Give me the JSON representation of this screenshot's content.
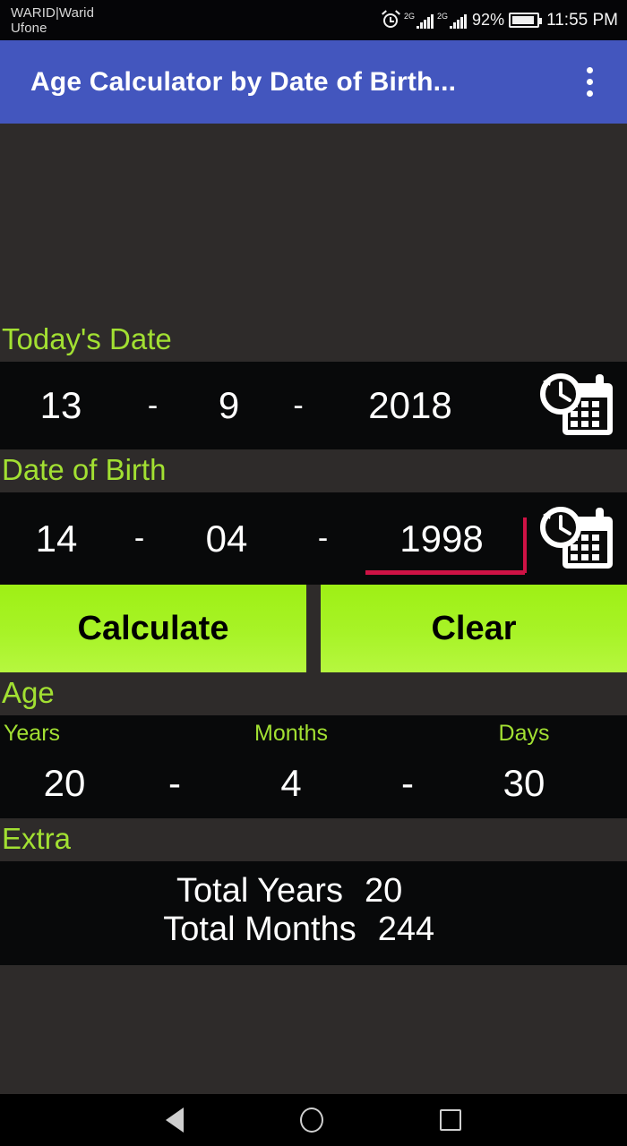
{
  "statusbar": {
    "carrier_line1": "WARID|Warid",
    "carrier_line2": "Ufone",
    "network_label_1": "2G",
    "network_label_2": "2G",
    "battery_percent": "92%",
    "time": "11:55 PM",
    "icons": [
      "alarm-icon",
      "signal-icon",
      "battery-icon"
    ]
  },
  "appbar": {
    "title": "Age Calculator by Date of Birth...",
    "menu_icon": "overflow-menu-icon",
    "background_color": "#4356be"
  },
  "today": {
    "label": "Today's Date",
    "day": "13",
    "separator1": "-",
    "month": "9",
    "separator2": "-",
    "year": "2018",
    "picker_icon": "calendar-clock-icon"
  },
  "dob": {
    "label": "Date of Birth",
    "day": "14",
    "separator1": "-",
    "month": "04",
    "separator2": "-",
    "year": "1998",
    "focused_field": "year",
    "focus_color": "#cf1245",
    "picker_icon": "calendar-clock-icon"
  },
  "buttons": {
    "calculate": "Calculate",
    "clear": "Clear",
    "color": "#a8f327"
  },
  "age": {
    "label": "Age",
    "headers": [
      "Years",
      "Months",
      "Days"
    ],
    "years": "20",
    "separator1": "-",
    "months": "4",
    "separator2": "-",
    "days": "30",
    "accent_color": "#a2e032"
  },
  "extra": {
    "label": "Extra",
    "rows": [
      {
        "label": "Total Years",
        "value": "20"
      },
      {
        "label": "Total Months",
        "value": "244"
      }
    ]
  },
  "navbar": {
    "back": "back-icon",
    "home": "home-icon",
    "recents": "recents-icon"
  }
}
